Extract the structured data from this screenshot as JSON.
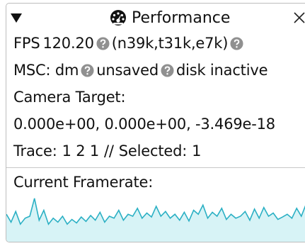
{
  "panel": {
    "title": "Performance",
    "title_icon": "speedometer-icon",
    "collapse_icon": "collapse-triangle-icon",
    "close_icon": "close-icon"
  },
  "stats": {
    "fps_label": "FPS",
    "fps_value": "120.20",
    "fps_counts": "(n39k,t31k,e7k)",
    "msc_label": "MSC: dm",
    "msc_saved": "unsaved",
    "msc_disk": "disk inactive",
    "camera_label": "Camera Target:",
    "camera_value": "0.000e+00, 0.000e+00, -3.469e-18",
    "trace_label": "Trace:",
    "trace_value": "1 2 1",
    "trace_sep": "//",
    "selected_label": "Selected:",
    "selected_value": "1",
    "help_icon": "help-circle-icon"
  },
  "framerate": {
    "label": "Current Framerate:",
    "line_color": "#2bb0c4",
    "fill_color": "#d7f3f6",
    "samples": [
      0.55,
      0.35,
      0.62,
      0.3,
      0.45,
      0.5,
      0.95,
      0.4,
      0.65,
      0.3,
      0.45,
      0.35,
      0.5,
      0.3,
      0.42,
      0.33,
      0.48,
      0.37,
      0.52,
      0.4,
      0.6,
      0.35,
      0.5,
      0.45,
      0.65,
      0.4,
      0.55,
      0.5,
      0.7,
      0.45,
      0.58,
      0.48,
      0.75,
      0.5,
      0.62,
      0.45,
      0.55,
      0.4,
      0.6,
      0.38,
      0.65,
      0.55,
      0.78,
      0.45,
      0.6,
      0.5,
      0.7,
      0.42,
      0.55,
      0.45,
      0.5,
      0.62,
      0.4,
      0.68,
      0.45,
      0.72,
      0.5,
      0.58,
      0.42,
      0.48,
      0.55,
      0.45,
      0.7,
      0.5,
      0.8,
      0.55
    ]
  }
}
